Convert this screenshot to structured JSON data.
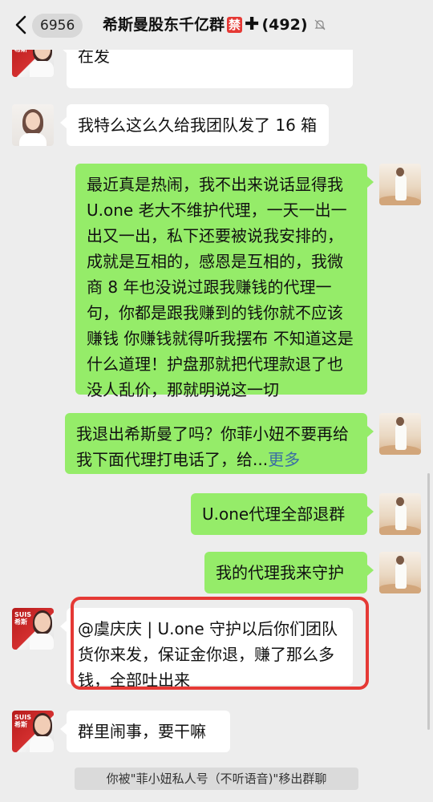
{
  "header": {
    "unread_count": "6956",
    "group_name": "希斯曼股东千亿群",
    "ban_tag": "禁",
    "plus": "✚",
    "member_count": "(492)"
  },
  "messages": [
    {
      "side": "left",
      "avatar": "red-brand-avatar",
      "text": "公司不能退款，谢谢，发货去。陆续在发"
    },
    {
      "side": "left",
      "avatar": "woman-avatar",
      "text": "我特么这么久给我团队发了 16 箱"
    },
    {
      "side": "right",
      "avatar": "desert-avatar",
      "text": "最近真是热闹，我不出来说话显得我 U.one 老大不维护代理，一天一出一出又一出，私下还要被说我安排的，成就是互相的，感恩是互相的，我微商 8 年也没说过跟我赚钱的代理一句，你都是跟我赚到的钱你就不应该赚钱 你赚钱就得听我摆布 不知道这是什么道理！护盘那就把代理款退了也没人乱价，那就明说这一切"
    },
    {
      "side": "right",
      "avatar": "desert-avatar",
      "text": "我退出希斯曼了吗？你菲小妞不要再给我下面代理打电话了，给...",
      "more": "更多"
    },
    {
      "side": "right",
      "avatar": "desert-avatar",
      "text": "U.one代理全部退群"
    },
    {
      "side": "right",
      "avatar": "desert-avatar",
      "text": "我的代理我来守护"
    },
    {
      "side": "left",
      "avatar": "red-brand-avatar",
      "text": "@虞庆庆 | U.one 守护以后你们团队货你来发，保证金你退，赚了那么多钱，全部吐出来"
    },
    {
      "side": "left",
      "avatar": "red-brand-avatar",
      "text": "群里闹事，要干嘛"
    }
  ],
  "system_message": "你被\"菲小妞私人号（不听语音)\"移出群聊",
  "colors": {
    "background": "#ededed",
    "self_bubble": "#95ec69",
    "other_bubble": "#ffffff",
    "highlight_box": "#e53935",
    "link_more": "#3b6ea5"
  }
}
